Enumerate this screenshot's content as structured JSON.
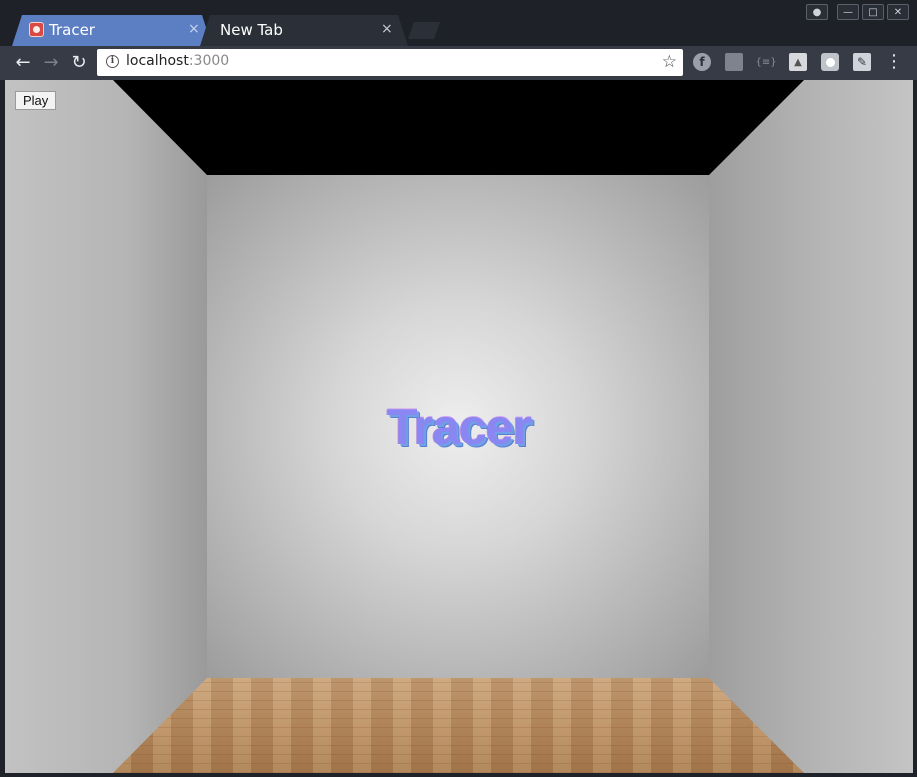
{
  "window": {
    "controls": {
      "profile_icon": "person-icon",
      "minimize_icon": "minimize-icon",
      "maximize_icon": "maximize-icon",
      "close_icon": "close-icon"
    }
  },
  "tabs": [
    {
      "title": "Tracer",
      "active": true,
      "close_glyph": "×"
    },
    {
      "title": "New Tab",
      "active": false,
      "close_glyph": "×"
    }
  ],
  "toolbar": {
    "back_glyph": "←",
    "forward_glyph": "→",
    "reload_glyph": "↻",
    "url_host": "localhost",
    "url_port": ":3000",
    "info_glyph": "i",
    "star_glyph": "☆",
    "menu_glyph": "⋮",
    "extensions": [
      "fedora-icon",
      "document-icon",
      "json-icon",
      "drive-icon",
      "record-icon",
      "wrench-icon"
    ]
  },
  "page": {
    "play_label": "Play",
    "scene_text": "Tracer",
    "colors": {
      "ceiling": "#000000",
      "text_primary": "#8a86f2",
      "floor": "#b98e62"
    }
  }
}
